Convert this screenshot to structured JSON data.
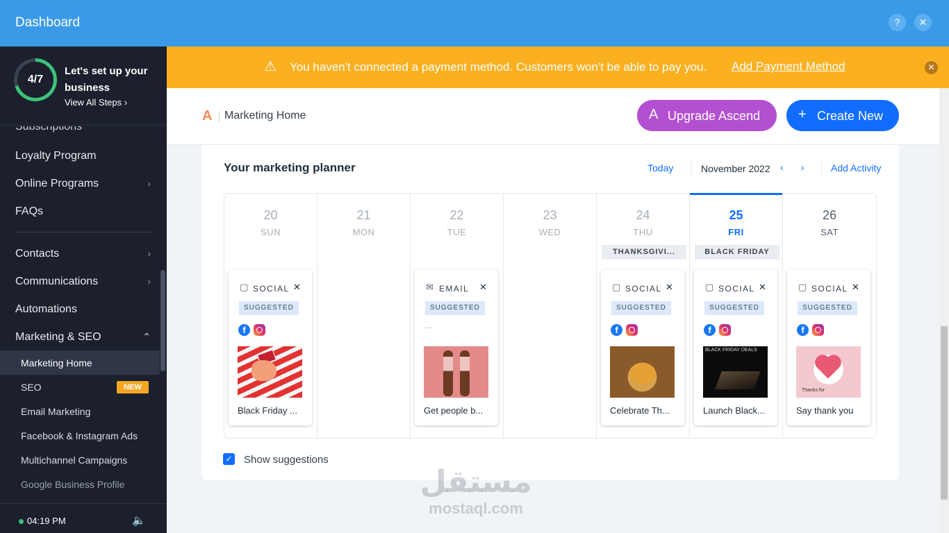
{
  "window": {
    "title": "Dashboard",
    "help_icon": "?",
    "close_icon": "✕"
  },
  "sidebar": {
    "setup": {
      "progress": "4/7",
      "progress_fraction": 0.571,
      "title": "Let's set up your business",
      "link": "View All Steps ›"
    },
    "partial_item": "Subscriptions",
    "items": [
      {
        "label": "Loyalty Program",
        "chevron": ""
      },
      {
        "label": "Online Programs",
        "chevron": "›"
      },
      {
        "label": "FAQs",
        "chevron": ""
      },
      {
        "label": "Contacts",
        "chevron": "›"
      },
      {
        "label": "Communications",
        "chevron": "›"
      },
      {
        "label": "Automations",
        "chevron": ""
      },
      {
        "label": "Marketing & SEO",
        "chevron": "⌃"
      }
    ],
    "sub_items": [
      {
        "label": "Marketing Home"
      },
      {
        "label": "SEO",
        "badge": "NEW"
      },
      {
        "label": "Email Marketing"
      },
      {
        "label": "Facebook & Instagram Ads"
      },
      {
        "label": "Multichannel Campaigns"
      },
      {
        "label": "Google Business Profile"
      }
    ],
    "footer": {
      "time": "04:19 PM"
    }
  },
  "banner": {
    "message": "You haven't connected a payment method. Customers won't be able to pay you.",
    "link": "Add Payment Method",
    "color": "#fbb020"
  },
  "header": {
    "breadcrumb": "Marketing Home",
    "upgrade_label": "Upgrade Ascend",
    "create_label": "Create New"
  },
  "planner": {
    "title": "Your marketing planner",
    "today_label": "Today",
    "month": "November 2022",
    "add_activity": "Add Activity",
    "show_suggestions": "Show suggestions",
    "show_suggestions_checked": true,
    "days": [
      {
        "num": "20",
        "name": "SUN",
        "holiday": "",
        "activity": {
          "kind": "SOCIAL",
          "tag": "SUGGESTED",
          "channels": [
            "facebook",
            "instagram"
          ],
          "caption": "Black Friday ..."
        }
      },
      {
        "num": "21",
        "name": "MON",
        "holiday": "",
        "activity": null
      },
      {
        "num": "22",
        "name": "TUE",
        "holiday": "",
        "activity": {
          "kind": "EMAIL",
          "tag": "SUGGESTED",
          "channels": [],
          "caption": "Get people b..."
        }
      },
      {
        "num": "23",
        "name": "WED",
        "holiday": "",
        "activity": null
      },
      {
        "num": "24",
        "name": "THU",
        "holiday": "THANKSGIVI...",
        "activity": {
          "kind": "SOCIAL",
          "tag": "SUGGESTED",
          "channels": [
            "facebook",
            "instagram"
          ],
          "caption": "Celebrate Th..."
        }
      },
      {
        "num": "25",
        "name": "FRI",
        "holiday": "BLACK FRIDAY",
        "current": true,
        "activity": {
          "kind": "SOCIAL",
          "tag": "SUGGESTED",
          "channels": [
            "facebook",
            "instagram"
          ],
          "caption": "Launch Black...",
          "image_text": "BLACK FRIDAY DEALS"
        }
      },
      {
        "num": "26",
        "name": "SAT",
        "holiday": "",
        "activity": {
          "kind": "SOCIAL",
          "tag": "SUGGESTED",
          "channels": [
            "facebook",
            "instagram"
          ],
          "caption": "Say thank you",
          "image_text": "Thanks for"
        }
      }
    ]
  },
  "watermark": {
    "arabic": "مستقل",
    "latin": "mostaql.com"
  }
}
